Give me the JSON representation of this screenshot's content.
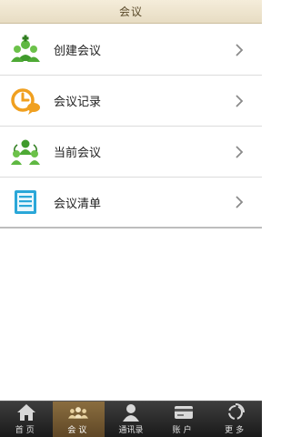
{
  "header": {
    "title": "会议"
  },
  "menu": {
    "items": [
      {
        "label": "创建会议",
        "icon": "create-meeting-icon"
      },
      {
        "label": "会议记录",
        "icon": "meeting-record-icon"
      },
      {
        "label": "当前会议",
        "icon": "current-meeting-icon"
      },
      {
        "label": "会议清单",
        "icon": "meeting-list-icon"
      }
    ]
  },
  "tabbar": {
    "tabs": [
      {
        "label": "首页",
        "icon": "home-icon",
        "active": false
      },
      {
        "label": "会议",
        "icon": "meeting-icon",
        "active": true
      },
      {
        "label": "通讯录",
        "icon": "contacts-icon",
        "active": false
      },
      {
        "label": "账户",
        "icon": "account-icon",
        "active": false
      },
      {
        "label": "更多",
        "icon": "more-icon",
        "active": false
      }
    ]
  },
  "colors": {
    "header_bg": "#efe5cf",
    "tabbar_bg": "#2a2a2a",
    "active_tab_bg": "#7a5f34",
    "icon_green": "#4caf50",
    "icon_orange": "#f0a020",
    "icon_blue": "#2aa7d8"
  }
}
